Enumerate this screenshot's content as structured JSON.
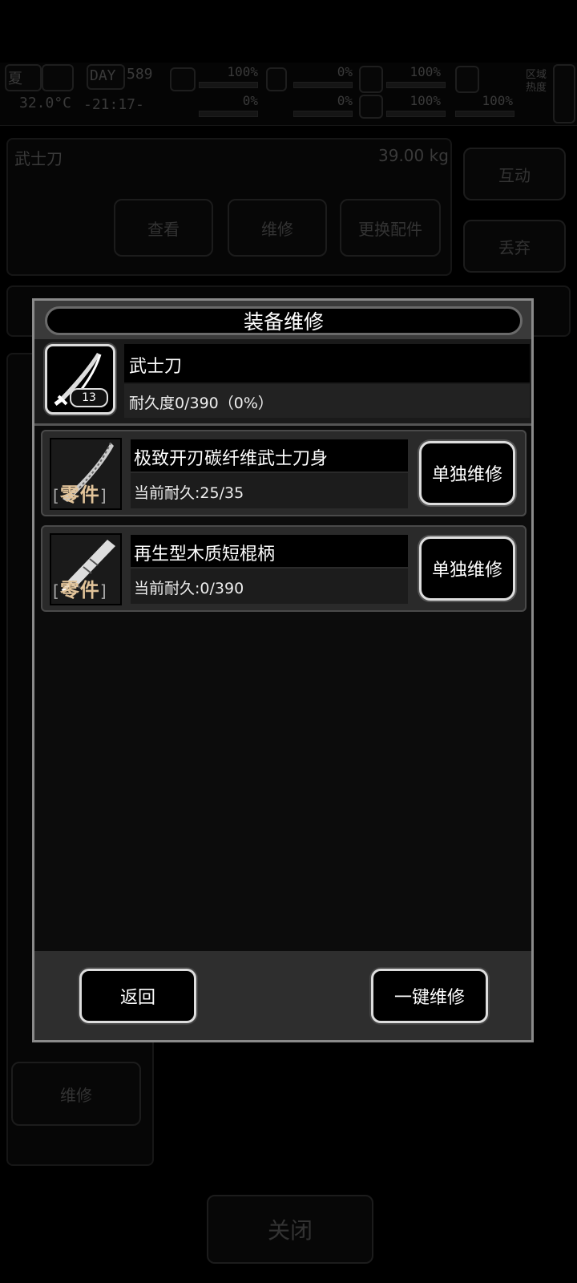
{
  "hud": {
    "season": "夏",
    "day_label": "DAY",
    "day_number": "589",
    "temperature": "32.0°C",
    "clock": "-21:17-",
    "stat_pcts": [
      "100%",
      "0%",
      "0%",
      "0%",
      "100%",
      "100%"
    ],
    "stamina_pct": "100%",
    "zone_heat_label": "区域热度"
  },
  "background": {
    "item_title": "武士刀",
    "item_weight": "39.00 kg",
    "buttons": {
      "view": "查看",
      "repair": "维修",
      "replace_parts": "更换配件",
      "interact": "互动",
      "discard": "丢弃",
      "side_repair": "维修",
      "close": "关闭"
    }
  },
  "dialog": {
    "title": "装备维修",
    "item": {
      "name": "武士刀",
      "level": "13",
      "durability": "耐久度0/390（0%）"
    },
    "parts": [
      {
        "tag": "零件",
        "name": "极致开刃碳纤维武士刀身",
        "durability": "当前耐久:25/35",
        "repair_label": "单独维修"
      },
      {
        "tag": "零件",
        "name": "再生型木质短棍柄",
        "durability": "当前耐久:0/390",
        "repair_label": "单独维修"
      }
    ],
    "footer": {
      "back_label": "返回",
      "repair_all_label": "一键维修"
    }
  },
  "colors": {
    "tag_gold": "#e2c49a",
    "dialog_border": "#8a8a8a",
    "button_border": "#dddddd"
  }
}
